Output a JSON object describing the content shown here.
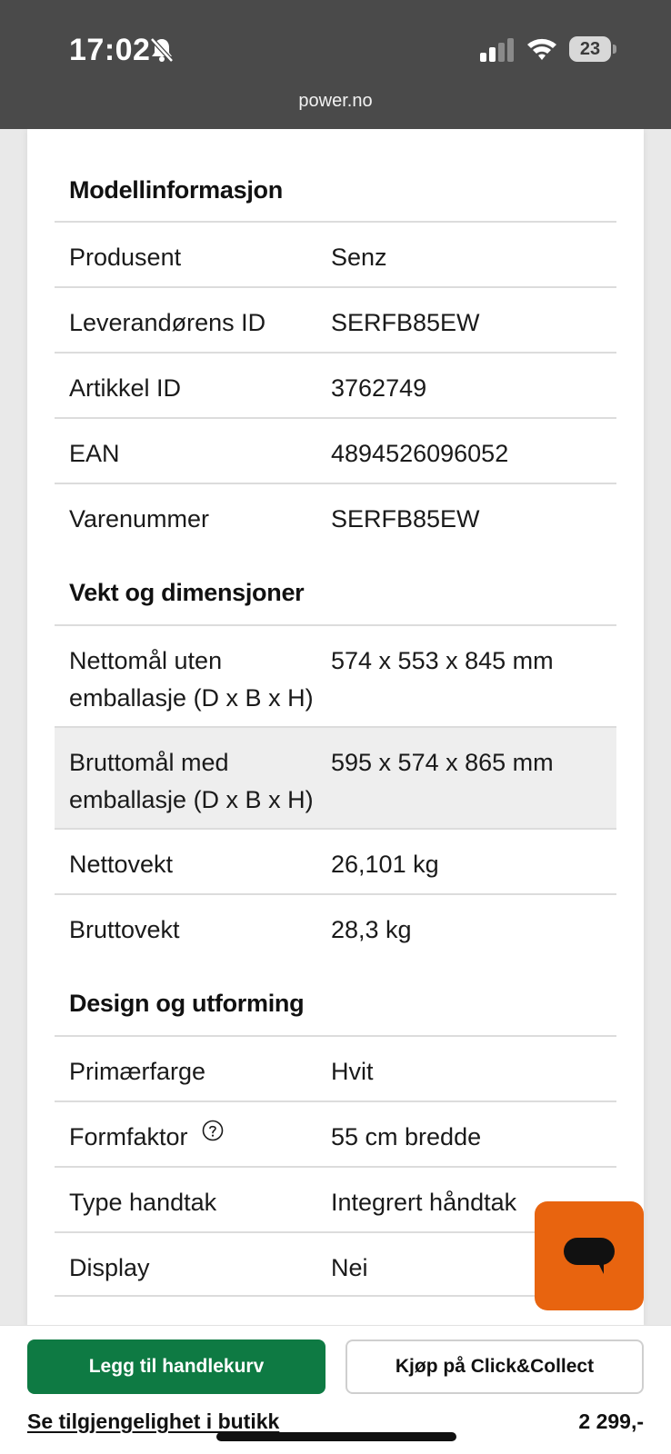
{
  "status_bar": {
    "time": "17:02",
    "battery": "23",
    "icons": [
      "bell-muted-icon",
      "signal-icon",
      "wifi-icon",
      "battery-icon"
    ]
  },
  "browser": {
    "url": "power.no"
  },
  "sections": {
    "model": {
      "title": "Modellinformasjon",
      "rows": [
        {
          "label": "Produsent",
          "value": "Senz"
        },
        {
          "label": "Leverandørens ID",
          "value": "SERFB85EW"
        },
        {
          "label": "Artikkel ID",
          "value": "3762749"
        },
        {
          "label": "EAN",
          "value": "4894526096052"
        },
        {
          "label": "Varenummer",
          "value": "SERFB85EW"
        }
      ]
    },
    "dimensions": {
      "title": "Vekt og dimensjoner",
      "rows": [
        {
          "label_line1": "Nettomål uten",
          "label_line2": "emballasje (D x B x H)",
          "value": "574 x 553 x 845 mm"
        },
        {
          "label_line1": "Bruttomål med",
          "label_line2": "emballasje (D x B x H)",
          "value": "595 x 574 x 865 mm"
        },
        {
          "label": "Nettovekt",
          "value": "26,101 kg"
        },
        {
          "label": "Bruttovekt",
          "value": "28,3 kg"
        }
      ]
    },
    "design": {
      "title": "Design og utforming",
      "rows": [
        {
          "label": "Primærfarge",
          "value": "Hvit"
        },
        {
          "label": "Formfaktor",
          "value": "55 cm bredde",
          "icon": "help-circle-icon"
        },
        {
          "label": "Type handtak",
          "value": "Integrert håndtak"
        },
        {
          "label": "Display",
          "value": "Nei"
        }
      ]
    }
  },
  "bottom_bar": {
    "add_to_cart": "Legg til handlekurv",
    "click_collect": "Kjøp på Click&Collect",
    "availability_link": "Se tilgjengelighet i butikk",
    "price": "2 299,-"
  },
  "colors": {
    "primary_green": "#0e7a43",
    "chat_orange": "#e8640f",
    "topbar": "#4a4a4a"
  }
}
